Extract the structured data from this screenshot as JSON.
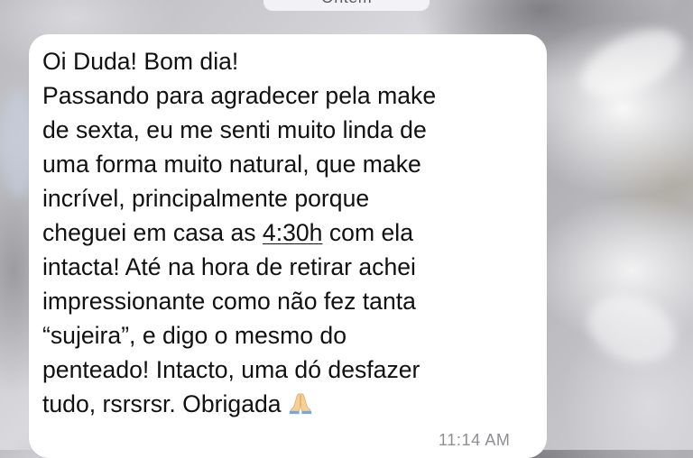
{
  "date_chip": "Ontem",
  "message": {
    "line1": "Oi Duda! Bom dia!",
    "line2": "Passando para agradecer pela make",
    "line3": "de sexta, eu me senti muito linda de",
    "line4": "uma forma muito natural, que make",
    "line5": "incrível, principalmente porque",
    "line6_before": "cheguei em casa as ",
    "line6_link": "4:30h",
    "line6_after": " com ela",
    "line7": "intacta! Até na hora de retirar achei",
    "line8": "impressionante como não fez tanta",
    "line9": "“sujeira”, e digo o mesmo do",
    "line10": "penteado! Intacto, uma dó desfazer",
    "line11": "tudo, rsrsrsr. Obrigada",
    "emoji_icon": "folded-hands-emoji",
    "time": "11:14 AM"
  },
  "colors": {
    "bubble": "#ffffff",
    "text": "#111111",
    "timestamp": "#8e8e93"
  }
}
